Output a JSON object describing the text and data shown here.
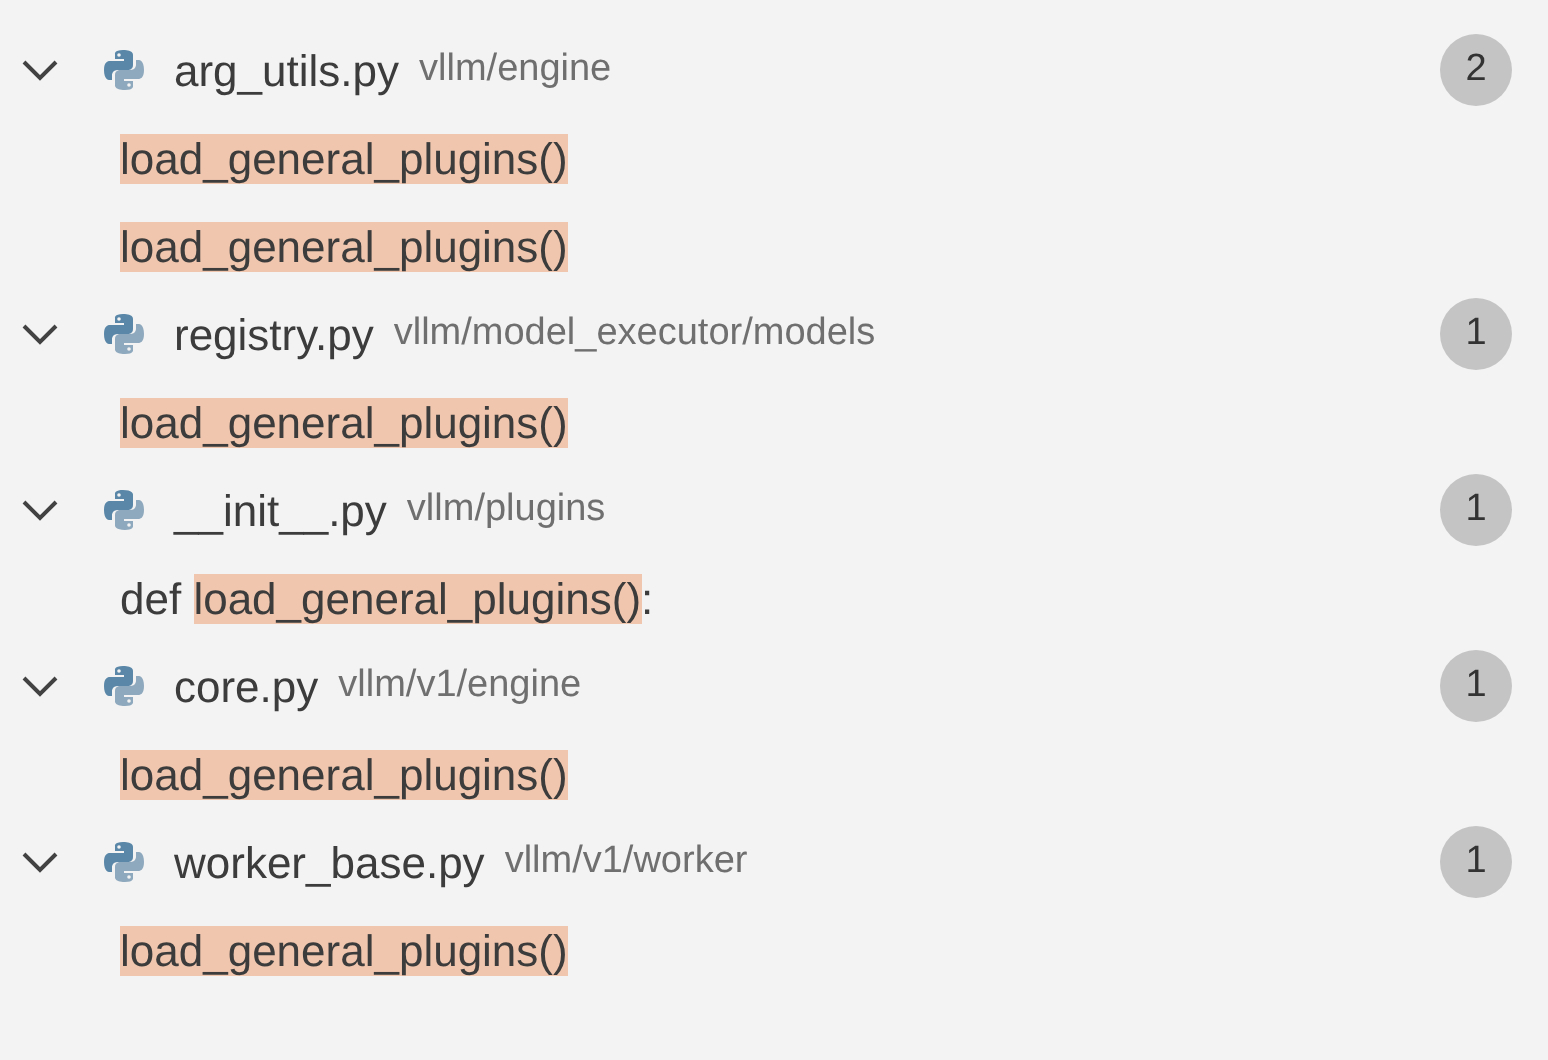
{
  "files": [
    {
      "name": "arg_utils.py",
      "path": "vllm/engine",
      "count": "2",
      "expanded": true,
      "matches": [
        {
          "match": "load_general_plugins()"
        },
        {
          "match": "load_general_plugins()"
        }
      ]
    },
    {
      "name": "registry.py",
      "path": "vllm/model_executor/models",
      "count": "1",
      "expanded": true,
      "matches": [
        {
          "match": "load_general_plugins()"
        }
      ]
    },
    {
      "name": "__init__.py",
      "path": "vllm/plugins",
      "count": "1",
      "expanded": true,
      "matches": [
        {
          "before": "def ",
          "match": "load_general_plugins()",
          "after": ":"
        }
      ]
    },
    {
      "name": "core.py",
      "path": "vllm/v1/engine",
      "count": "1",
      "expanded": true,
      "matches": [
        {
          "match": "load_general_plugins()"
        }
      ]
    },
    {
      "name": "worker_base.py",
      "path": "vllm/v1/worker",
      "count": "1",
      "expanded": true,
      "matches": [
        {
          "match": "load_general_plugins()"
        }
      ]
    }
  ]
}
